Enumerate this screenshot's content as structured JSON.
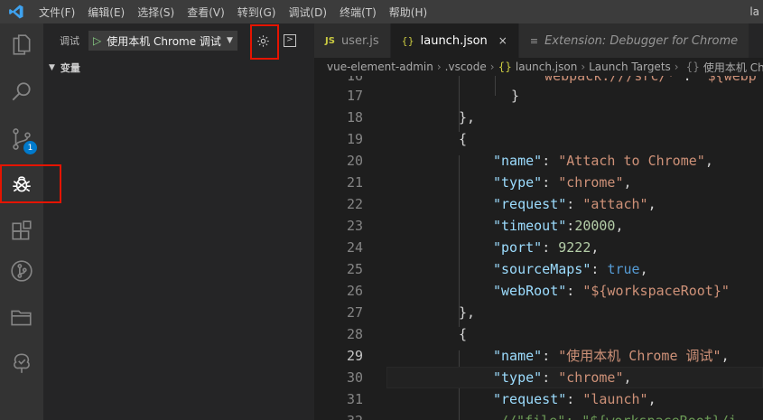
{
  "titlebar": {
    "menu": [
      "文件(F)",
      "编辑(E)",
      "选择(S)",
      "查看(V)",
      "转到(G)",
      "调试(D)",
      "终端(T)",
      "帮助(H)"
    ],
    "right_fragment": "la"
  },
  "activity": {
    "icons": [
      "files-icon",
      "search-icon",
      "source-control-icon",
      "debug-icon",
      "extensions-icon",
      "git-graph-icon",
      "folder-icon",
      "tree-icon"
    ],
    "scm_badge": "1",
    "accent": "#007acc"
  },
  "debug": {
    "title": "调试",
    "config": "使用本机 Chrome 调试",
    "variables_header": "变量"
  },
  "tabs": [
    {
      "icon": "JS",
      "label": "user.js"
    },
    {
      "icon": "{}",
      "label": "launch.json",
      "close": "×"
    },
    {
      "icon": "≡",
      "label": "Extension: Debugger for Chrome"
    }
  ],
  "breadcrumb": [
    "vue-element-admin",
    ".vscode",
    "launch.json",
    "Launch Targets",
    "使用本机 Chr"
  ],
  "code": {
    "line_numbers": [
      "16",
      "17",
      "18",
      "19",
      "20",
      "21",
      "22",
      "23",
      "24",
      "25",
      "26",
      "27",
      "28",
      "29",
      "30",
      "31",
      "32"
    ],
    "l16a": "\"webpack:///src/*\"",
    "l16b": ": ",
    "l16c": "\"${webp",
    "l17": "}",
    "l18": "},",
    "l19": "{",
    "l20k": "\"name\"",
    "l20v": "\"Attach to Chrome\"",
    "l21k": "\"type\"",
    "l21v": "\"chrome\"",
    "l22k": "\"request\"",
    "l22v": "\"attach\"",
    "l23k": "\"timeout\"",
    "l23v": "20000",
    "l24k": "\"port\"",
    "l24v": "9222",
    "l25k": "\"sourceMaps\"",
    "l25v": "true",
    "l26k": "\"webRoot\"",
    "l26v": "\"${workspaceRoot}\"",
    "l27": "},",
    "l28": "{",
    "l29k": "\"name\"",
    "l29v": "\"使用本机 Chrome 调试\"",
    "l30k": "\"type\"",
    "l30v": "\"chrome\"",
    "l31k": "\"request\"",
    "l31v": "\"launch\"",
    "l32": "//\"file\": \"${workspaceRoot}/i"
  }
}
